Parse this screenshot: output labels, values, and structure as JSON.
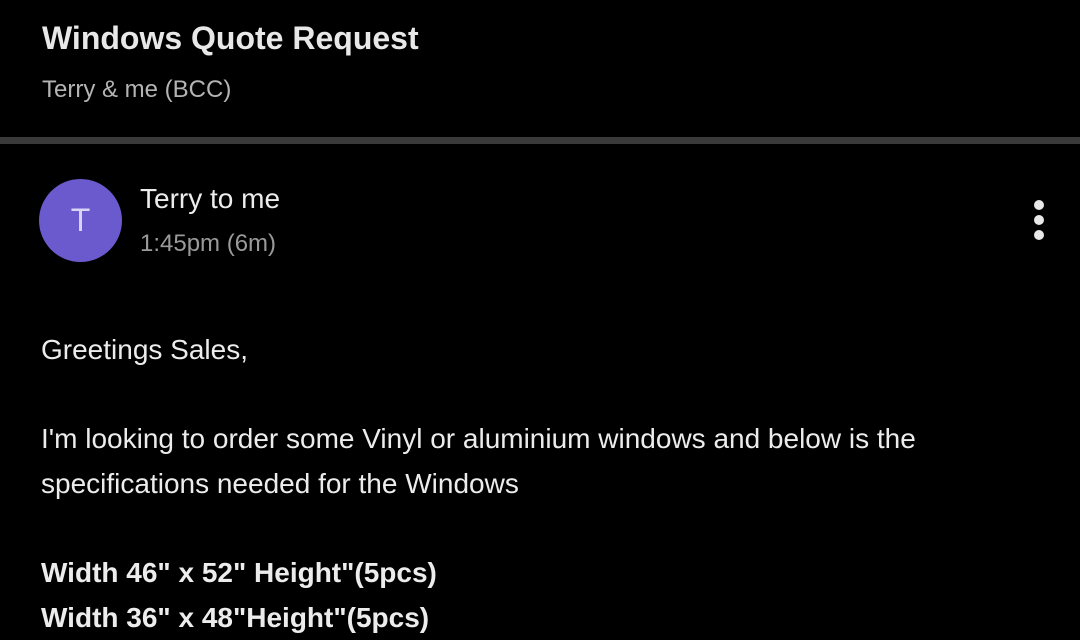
{
  "email": {
    "subject": "Windows Quote Request",
    "participants": "Terry & me (BCC)"
  },
  "message": {
    "avatar_letter": "T",
    "avatar_color": "#6a5acd",
    "sender_line": "Terry to me",
    "timestamp": "1:45pm (6m)",
    "more_icon": "more-vert-icon",
    "greeting": "Greetings Sales,",
    "intro": "I'm looking to order some Vinyl or aluminium windows and below is the specifications needed for the Windows",
    "specs": [
      "Width 46\" x 52\" Height\"(5pcs)",
      "Width 36\" x 48\"Height\"(5pcs)"
    ]
  },
  "colors": {
    "background": "#000000",
    "divider": "#3a3a3a",
    "text_primary": "#ececec",
    "text_secondary": "#9a9a9a"
  }
}
